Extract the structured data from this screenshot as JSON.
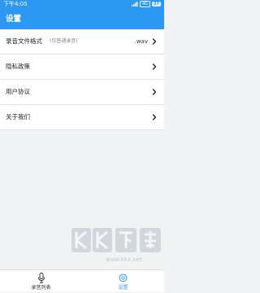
{
  "status_bar": {
    "time": "下午4:05",
    "signal_box": "4G",
    "battery": "37"
  },
  "header": {
    "title": "设置"
  },
  "settings": {
    "items": [
      {
        "label": "录音文件格式",
        "sub": "(仅普通录音)",
        "value": ".wav"
      },
      {
        "label": "隐私政策",
        "sub": "",
        "value": ""
      },
      {
        "label": "用户协议",
        "sub": "",
        "value": ""
      },
      {
        "label": "关于我们",
        "sub": "",
        "value": ""
      }
    ]
  },
  "bottom_nav": {
    "items": [
      {
        "label": "录音列表",
        "icon": "microphone-icon",
        "active": false
      },
      {
        "label": "设置",
        "icon": "gear-icon",
        "active": true
      }
    ]
  },
  "watermark": {
    "brand": "KK下载",
    "url": "www.kkx.net"
  },
  "colors": {
    "primary": "#2d98f3",
    "background": "#f1f2f4"
  }
}
